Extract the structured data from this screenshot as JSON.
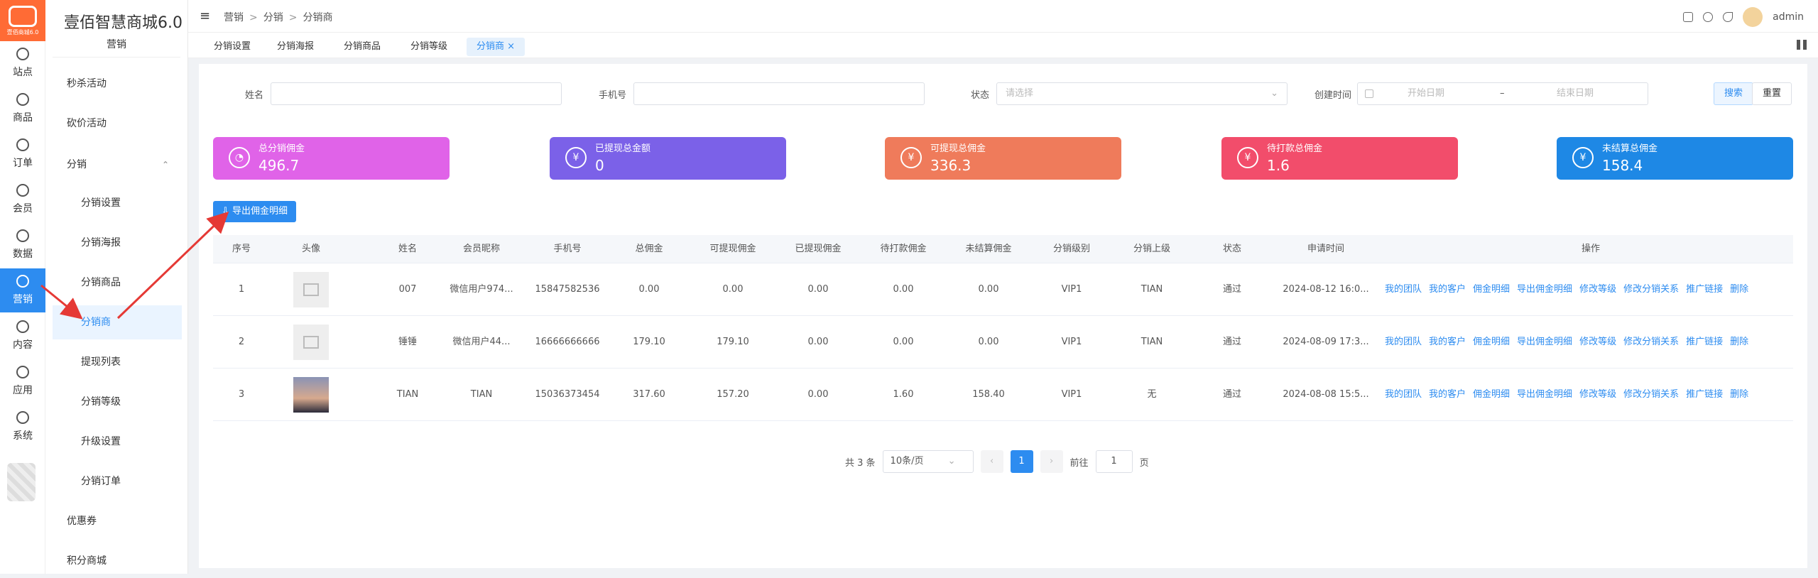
{
  "logo_version": "壹佰商城6.0",
  "rail": [
    {
      "label": "站点",
      "icon": "globe-icon"
    },
    {
      "label": "商品",
      "icon": "cube-icon"
    },
    {
      "label": "订单",
      "icon": "clipboard-icon"
    },
    {
      "label": "会员",
      "icon": "user-icon"
    },
    {
      "label": "数据",
      "icon": "clock-icon"
    },
    {
      "label": "营销",
      "icon": "target-icon"
    },
    {
      "label": "内容",
      "icon": "folder-icon"
    },
    {
      "label": "应用",
      "icon": "box-icon"
    },
    {
      "label": "系统",
      "icon": "gear-icon"
    }
  ],
  "sidebar": {
    "brand": "壹佰智慧商城6.0",
    "section": "营销",
    "items": [
      {
        "label": "秒杀活动"
      },
      {
        "label": "砍价活动"
      },
      {
        "label": "分销",
        "chev": "⌃"
      },
      {
        "label": "分销设置"
      },
      {
        "label": "分销海报"
      },
      {
        "label": "分销商品"
      },
      {
        "label": "分销商"
      },
      {
        "label": "提现列表"
      },
      {
        "label": "分销等级"
      },
      {
        "label": "升级设置"
      },
      {
        "label": "分销订单"
      },
      {
        "label": "优惠券"
      },
      {
        "label": "积分商城"
      }
    ]
  },
  "header": {
    "menu_icon": "≡",
    "breadcrumb": [
      "营销",
      "分销",
      "分销商"
    ],
    "sep": ">",
    "user": "admin"
  },
  "tabs": [
    "分销设置",
    "分销海报",
    "分销商品",
    "分销等级",
    "分销商 ×"
  ],
  "filters": {
    "name_label": "姓名",
    "phone_label": "手机号",
    "status_label": "状态",
    "status_placeholder": "请选择",
    "time_label": "创建时间",
    "start_placeholder": "开始日期",
    "dash": "–",
    "end_placeholder": "结束日期",
    "search": "搜索",
    "reset": "重置"
  },
  "cards": [
    {
      "title": "总分销佣金",
      "value": "496.7",
      "color": "#e063e8",
      "icon": "◔"
    },
    {
      "title": "已提现总金额",
      "value": "0",
      "color": "#7b61e8",
      "icon": "¥"
    },
    {
      "title": "可提现总佣金",
      "value": "336.3",
      "color": "#ef7b5b",
      "icon": "¥"
    },
    {
      "title": "待打款总佣金",
      "value": "1.6",
      "color": "#f24d6b",
      "icon": "¥"
    },
    {
      "title": "未结算总佣金",
      "value": "158.4",
      "color": "#1e88e5",
      "icon": "¥"
    }
  ],
  "export_label": "导出佣金明细",
  "table": {
    "headers": [
      "序号",
      "头像",
      "姓名",
      "会员昵称",
      "手机号",
      "总佣金",
      "可提现佣金",
      "已提现佣金",
      "待打款佣金",
      "未结算佣金",
      "分销级别",
      "分销上级",
      "状态",
      "申请时间",
      "操作"
    ],
    "rows": [
      {
        "no": "1",
        "name": "007",
        "nick": "微信用户974...",
        "phone": "15847582536",
        "total": "0.00",
        "avail": "0.00",
        "withdrawn": "0.00",
        "pending": "0.00",
        "unsettled": "0.00",
        "level": "VIP1",
        "parent": "TIAN",
        "status": "通过",
        "time": "2024-08-12 16:0...",
        "avatar": "placeholder"
      },
      {
        "no": "2",
        "name": "锤锤",
        "nick": "微信用户44...",
        "phone": "16666666666",
        "total": "179.10",
        "avail": "179.10",
        "withdrawn": "0.00",
        "pending": "0.00",
        "unsettled": "0.00",
        "level": "VIP1",
        "parent": "TIAN",
        "status": "通过",
        "time": "2024-08-09 17:3...",
        "avatar": "placeholder"
      },
      {
        "no": "3",
        "name": "TIAN",
        "nick": "TIAN",
        "phone": "15036373454",
        "total": "317.60",
        "avail": "157.20",
        "withdrawn": "0.00",
        "pending": "1.60",
        "unsettled": "158.40",
        "level": "VIP1",
        "parent": "无",
        "status": "通过",
        "time": "2024-08-08 15:5...",
        "avatar": "photo"
      }
    ],
    "ops": [
      "我的团队",
      "我的客户",
      "佣金明细",
      "导出佣金明细",
      "修改等级",
      "修改分销关系",
      "推广链接",
      "删除"
    ]
  },
  "pager": {
    "total": "共 3 条",
    "size": "10条/页",
    "prev": "‹",
    "page": "1",
    "next": "›",
    "goto": "前往",
    "goto_value": "1",
    "unit": "页"
  }
}
